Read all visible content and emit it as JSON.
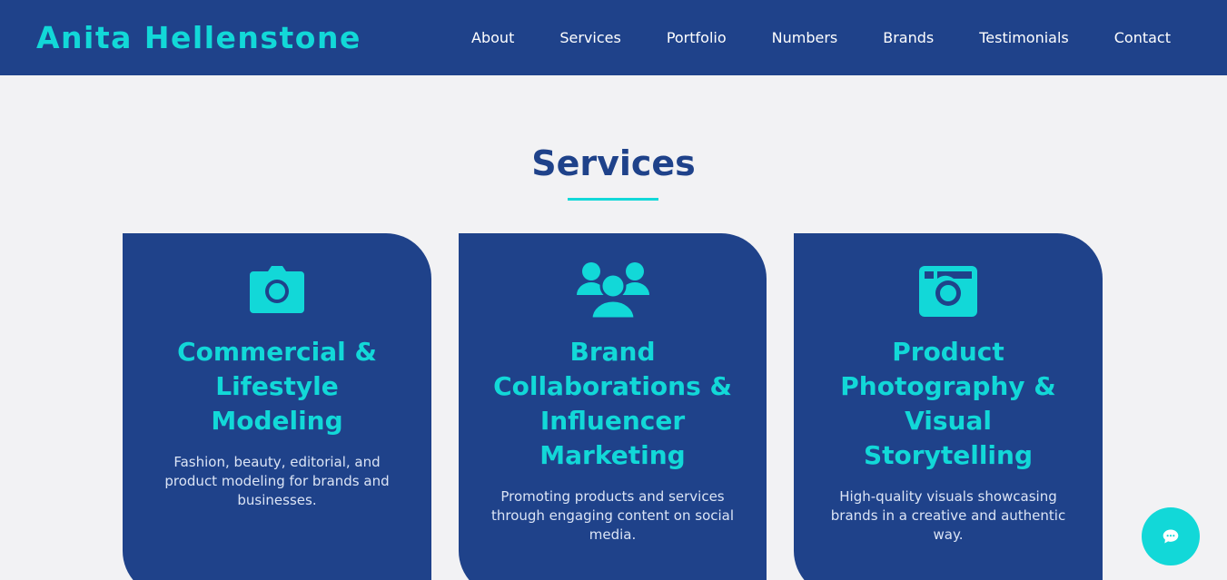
{
  "navbar": {
    "brand": "Anita Hellenstone",
    "links": [
      "About",
      "Services",
      "Portfolio",
      "Numbers",
      "Brands",
      "Testimonials",
      "Contact"
    ]
  },
  "services": {
    "title": "Services",
    "cards": [
      {
        "icon": "camera-icon",
        "title": "Commercial & Lifestyle Modeling",
        "description": "Fashion, beauty, editorial, and product modeling for brands and businesses."
      },
      {
        "icon": "users-icon",
        "title": "Brand Collaborations & Influencer Marketing",
        "description": "Promoting products and services through engaging content on social media."
      },
      {
        "icon": "camera-retro-icon",
        "title": "Product Photography & Visual Storytelling",
        "description": "High-quality visuals showcasing brands in a creative and authentic way."
      }
    ]
  },
  "chat": {
    "icon": "chat-icon"
  },
  "colors": {
    "primary": "#1f428a",
    "accent": "#12d8d8",
    "background": "#f2f2f4"
  }
}
